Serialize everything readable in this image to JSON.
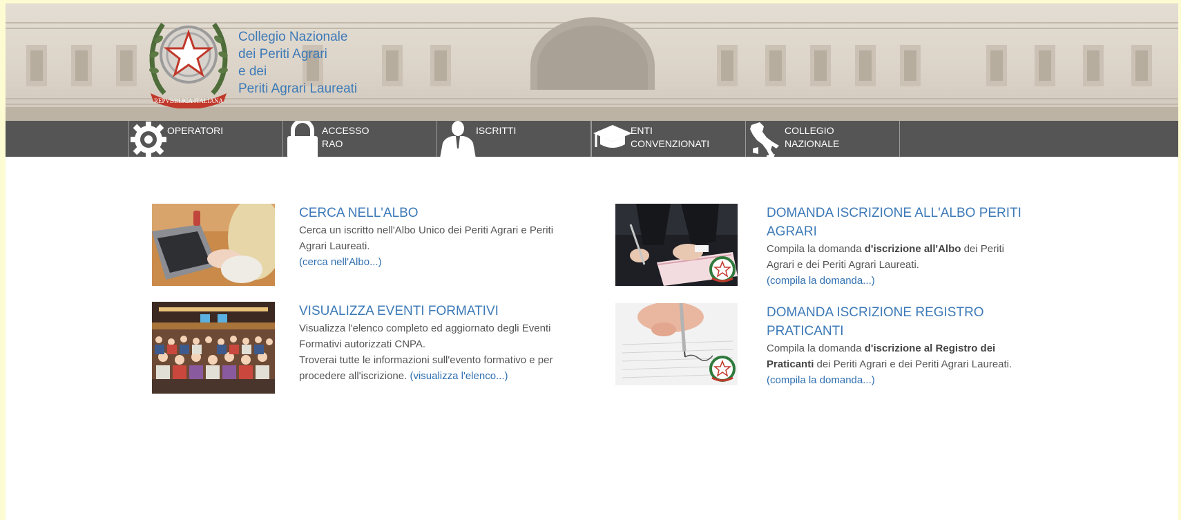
{
  "brand": {
    "lines": [
      "Collegio Nazionale",
      "dei Periti Agrari",
      "e dei",
      "Periti Agrari Laureati"
    ],
    "emblem_text": "REPVBBLICA ITALIANA"
  },
  "nav": {
    "items": [
      {
        "icon": "gear-icon",
        "lines": [
          "OPERATORI"
        ]
      },
      {
        "icon": "lock-icon",
        "lines": [
          "ACCESSO",
          "RAO"
        ]
      },
      {
        "icon": "person-icon",
        "lines": [
          "ISCRITTI"
        ]
      },
      {
        "icon": "graduation-cap-icon",
        "lines": [
          "ENTI",
          "CONVENZIONATI"
        ]
      },
      {
        "icon": "italy-map-icon",
        "lines": [
          "COLLEGIO",
          "NAZIONALE"
        ]
      }
    ]
  },
  "cards": {
    "albo": {
      "title": "CERCA NELL'ALBO",
      "text": "Cerca un iscritto nell'Albo Unico dei Periti Agrari e Periti Agrari Laureati.",
      "link": "(cerca nell'Albo...)",
      "image": "laptop-photo"
    },
    "eventi": {
      "title": "VISUALIZZA EVENTI FORMATIVI",
      "text1": "Visualizza l'elenco completo ed aggiornato degli Eventi Formativi autorizzati CNPA.",
      "text2": "Troverai tutte le informazioni sull'evento formativo e per procedere all'iscrizione.",
      "link": "(visualizza l'elenco...)",
      "image": "conference-photo"
    },
    "domanda_albo": {
      "title": "DOMANDA ISCRIZIONE ALL'ALBO PERITI AGRARI",
      "text_pre": "Compila la domanda ",
      "text_bold": "d'iscrizione all'Albo",
      "text_post": " dei Periti Agrari e dei Periti Agrari Laureati.",
      "link": "(compila la domanda...)",
      "image": "signing-photo"
    },
    "domanda_registro": {
      "title": "DOMANDA ISCRIZIONE REGISTRO PRATICANTI",
      "text_pre": "Compila la domanda ",
      "text_bold": "d'iscrizione al Registro dei Praticanti",
      "text_post": " dei Periti Agrari e dei Periti Agrari Laureati.",
      "link": "(compila la domanda...)",
      "image": "pen-document-photo"
    }
  },
  "colors": {
    "page_background": "#fcfbd2",
    "nav_background": "#555555",
    "brand_blue": "#3d7ab8",
    "link_blue": "#2f6fb0"
  }
}
